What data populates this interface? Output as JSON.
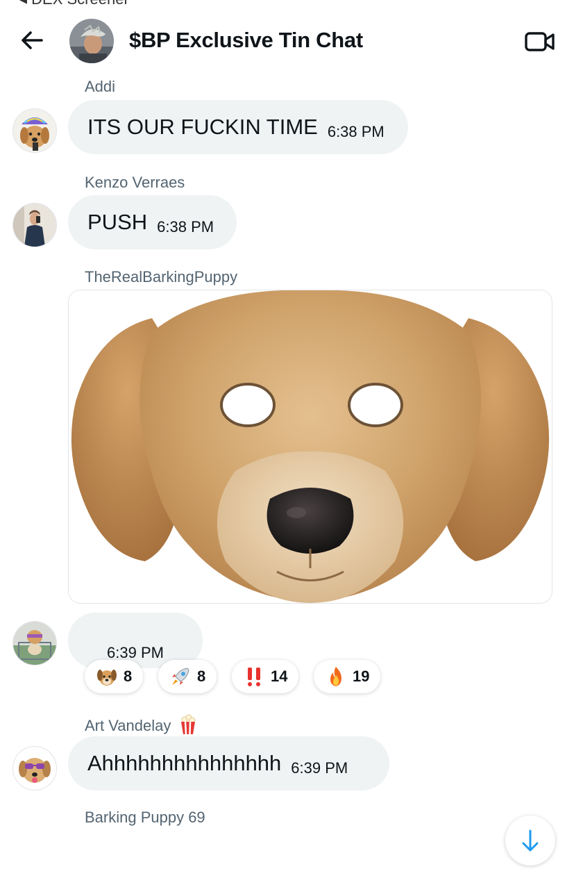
{
  "status_bar": {
    "back_app": "◂ DEX Screener"
  },
  "header": {
    "title": "$BP Exclusive Tin Chat",
    "icons": {
      "back": "arrow-left-icon",
      "video": "video-camera-icon"
    }
  },
  "messages": [
    {
      "sender": "Addi",
      "text": "ITS OUR FUCKIN TIME",
      "time": "6:38 PM"
    },
    {
      "sender": "Kenzo Verraes",
      "text": "PUSH",
      "time": "6:38 PM"
    },
    {
      "sender": "TheRealBarkingPuppy",
      "media": "dog-face-mask-image"
    },
    {
      "sender": "",
      "text": "",
      "time": "6:39 PM",
      "reactions": [
        {
          "emoji": "dog-face-icon",
          "count": "8"
        },
        {
          "emoji": "rocket-icon",
          "count": "8"
        },
        {
          "emoji": "double-exclamation-icon",
          "count": "14"
        },
        {
          "emoji": "fire-icon",
          "count": "19"
        }
      ]
    },
    {
      "sender": "Art Vandelay",
      "sender_badge": "popcorn-icon",
      "text": "Ahhhhhhhhhhhhhhh",
      "time": "6:39 PM"
    },
    {
      "sender": "Barking Puppy 69"
    }
  ],
  "colors": {
    "bubble": "#eff3f4",
    "secondary_text": "#536471",
    "fur": "#c89a63"
  }
}
